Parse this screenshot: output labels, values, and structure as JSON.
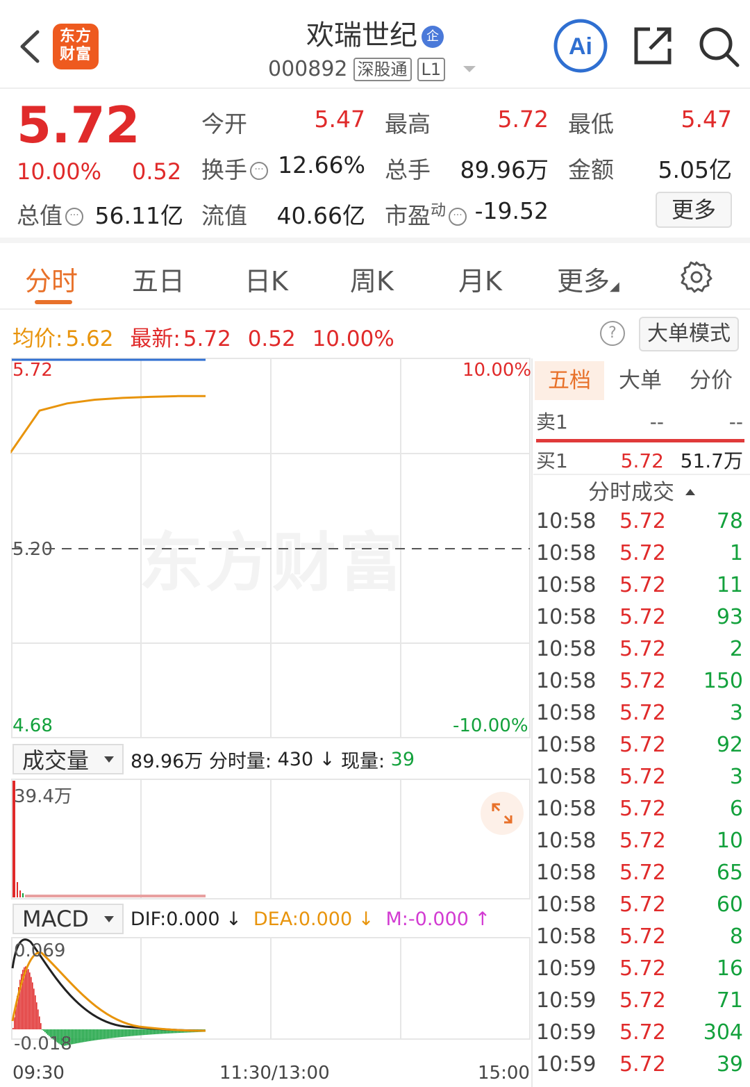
{
  "header": {
    "stock_name": "欢瑞世纪",
    "corp_badge": "企",
    "stock_code": "000892",
    "market_tag": "深股通",
    "level_tag": "L1",
    "logo_text_line1": "东方",
    "logo_text_line2": "财富",
    "ai_label": "Ai"
  },
  "quote": {
    "price": "5.72",
    "change_pct": "10.00%",
    "change": "0.52",
    "fields": {
      "open_label": "今开",
      "open": "5.47",
      "high_label": "最高",
      "high": "5.72",
      "low_label": "最低",
      "low": "5.47",
      "turnover_label": "换手",
      "turnover": "12.66%",
      "volume_label": "总手",
      "volume": "89.96万",
      "amount_label": "金额",
      "amount": "5.05亿",
      "total_mv_label": "总值",
      "total_mv": "56.11亿",
      "float_mv_label": "流值",
      "float_mv": "40.66亿",
      "pe_label": "市盈",
      "pe_sup": "动",
      "pe": "-19.52"
    },
    "more_label": "更多"
  },
  "tabs": [
    "分时",
    "五日",
    "日K",
    "周K",
    "月K",
    "更多"
  ],
  "summary": {
    "avg_label": "均价:",
    "avg": "5.62",
    "latest_label": "最新:",
    "latest": "5.72",
    "latest_chg": "0.52",
    "latest_pct": "10.00%",
    "help": "?",
    "bigorder_label": "大单模式"
  },
  "chart": {
    "price_high": "5.72",
    "price_mid": "5.20",
    "price_low": "4.68",
    "pct_high": "10.00%",
    "pct_low": "-10.00%",
    "watermark": "东方财富",
    "time_start": "09:30",
    "time_mid": "11:30/13:00",
    "time_end": "15:00"
  },
  "chart_data": {
    "type": "line",
    "title": "",
    "xlabel": "",
    "ylabel": "",
    "x": [
      "09:30",
      "09:35",
      "09:45",
      "10:00",
      "10:15",
      "10:30",
      "10:45",
      "10:59"
    ],
    "series": [
      {
        "name": "price",
        "values": [
          5.72,
          5.72,
          5.72,
          5.72,
          5.72,
          5.72,
          5.72,
          5.72
        ],
        "color": "#2f6fd1"
      },
      {
        "name": "avg",
        "values": [
          5.47,
          5.58,
          5.6,
          5.61,
          5.615,
          5.618,
          5.62,
          5.62
        ],
        "color": "#e8940c"
      }
    ],
    "ylim": [
      4.68,
      5.72
    ],
    "x_axis_ticks": [
      "09:30",
      "11:30/13:00",
      "15:00"
    ],
    "grid": true
  },
  "volume": {
    "selector_label": "成交量",
    "total": "89.96万",
    "period_label": "分时量:",
    "period": "430",
    "period_arrow": "↓",
    "current_label": "现量:",
    "current": "39",
    "max_label": "39.4万"
  },
  "macd": {
    "selector_label": "MACD",
    "dif": "DIF:0.000 ↓",
    "dea": "DEA:0.000 ↓",
    "m": "M:-0.000 ↑",
    "max_label": "0.069",
    "min_label": "-0.018"
  },
  "orderbook": {
    "tabs": [
      "五档",
      "大单",
      "分价"
    ],
    "sell1": {
      "label": "卖1",
      "price": "--",
      "vol": "--"
    },
    "buy1": {
      "label": "买1",
      "price": "5.72",
      "vol": "51.7万"
    },
    "ticks_header": "分时成交",
    "ticks": [
      {
        "time": "10:58",
        "price": "5.72",
        "vol": "78"
      },
      {
        "time": "10:58",
        "price": "5.72",
        "vol": "1"
      },
      {
        "time": "10:58",
        "price": "5.72",
        "vol": "11"
      },
      {
        "time": "10:58",
        "price": "5.72",
        "vol": "93"
      },
      {
        "time": "10:58",
        "price": "5.72",
        "vol": "2"
      },
      {
        "time": "10:58",
        "price": "5.72",
        "vol": "150"
      },
      {
        "time": "10:58",
        "price": "5.72",
        "vol": "3"
      },
      {
        "time": "10:58",
        "price": "5.72",
        "vol": "92"
      },
      {
        "time": "10:58",
        "price": "5.72",
        "vol": "3"
      },
      {
        "time": "10:58",
        "price": "5.72",
        "vol": "6"
      },
      {
        "time": "10:58",
        "price": "5.72",
        "vol": "10"
      },
      {
        "time": "10:58",
        "price": "5.72",
        "vol": "65"
      },
      {
        "time": "10:58",
        "price": "5.72",
        "vol": "60"
      },
      {
        "time": "10:58",
        "price": "5.72",
        "vol": "8"
      },
      {
        "time": "10:59",
        "price": "5.72",
        "vol": "16"
      },
      {
        "time": "10:59",
        "price": "5.72",
        "vol": "71"
      },
      {
        "time": "10:59",
        "price": "5.72",
        "vol": "304"
      },
      {
        "time": "10:59",
        "price": "5.72",
        "vol": "39"
      }
    ]
  },
  "colors": {
    "up": "#e02a2a",
    "down": "#13a13c",
    "accent": "#e8712a",
    "avg": "#e8940c",
    "price_line": "#2f6fd1"
  }
}
